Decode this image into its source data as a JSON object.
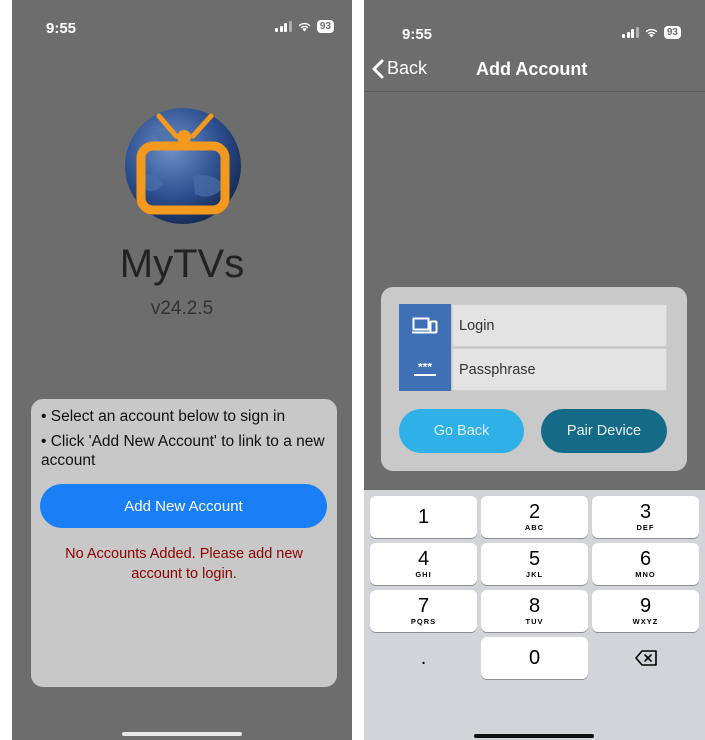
{
  "left_screen": {
    "status": {
      "time": "9:55",
      "battery": "93"
    },
    "app": {
      "name": "MyTVs",
      "version": "v24.2.5"
    },
    "instructions": [
      "• Select an account below to sign in",
      "• Click 'Add New Account' to link to a new account"
    ],
    "add_account_button": "Add New Account",
    "empty_message": "No Accounts Added. Please add new account to login."
  },
  "right_screen": {
    "status": {
      "time": "9:55",
      "battery": "93"
    },
    "nav": {
      "back_label": "Back",
      "title": "Add Account"
    },
    "form": {
      "login_placeholder": "Login",
      "passphrase_placeholder": "Passphrase",
      "go_back_button": "Go Back",
      "pair_button": "Pair Device",
      "icons": [
        "device-icon",
        "password-icon"
      ]
    },
    "keypad": {
      "keys": [
        {
          "digit": "1",
          "letters": ""
        },
        {
          "digit": "2",
          "letters": "ABC"
        },
        {
          "digit": "3",
          "letters": "DEF"
        },
        {
          "digit": "4",
          "letters": "GHI"
        },
        {
          "digit": "5",
          "letters": "JKL"
        },
        {
          "digit": "6",
          "letters": "MNO"
        },
        {
          "digit": "7",
          "letters": "PQRS"
        },
        {
          "digit": "8",
          "letters": "TUV"
        },
        {
          "digit": "9",
          "letters": "WXYZ"
        },
        {
          "digit": ".",
          "letters": ""
        },
        {
          "digit": "0",
          "letters": ""
        }
      ]
    }
  },
  "colors": {
    "background": "#6d6d6d",
    "accent_blue": "#1a7ff6",
    "error_red": "#8b0000",
    "go_back": "#2fb0e6",
    "pair_device": "#156b87",
    "field_icon_bg": "#3f6fb4",
    "logo_orange": "#f39a1e"
  }
}
